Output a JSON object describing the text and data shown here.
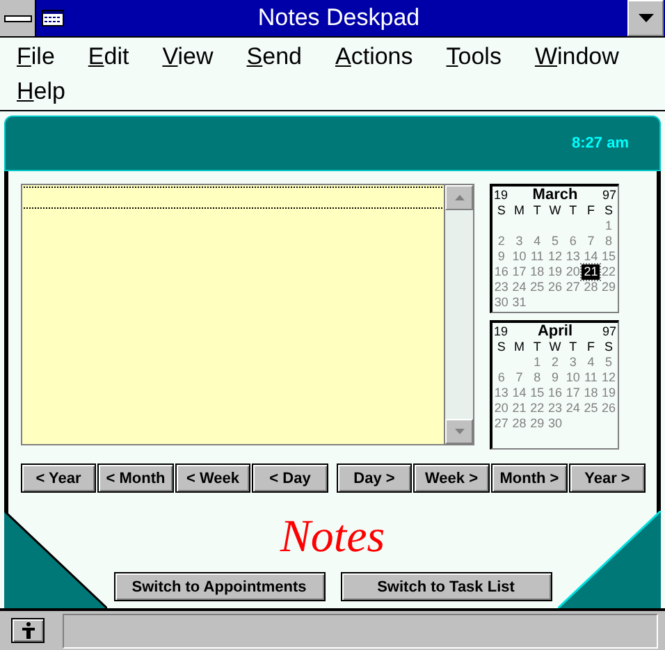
{
  "window": {
    "title": "Notes Deskpad"
  },
  "menu": [
    "File",
    "Edit",
    "View",
    "Send",
    "Actions",
    "Tools",
    "Window",
    "Help"
  ],
  "header": {
    "time": "8:27 am"
  },
  "calendars": [
    {
      "century": "19",
      "month": "March",
      "year": "97",
      "weekdays": [
        "S",
        "M",
        "T",
        "W",
        "T",
        "F",
        "S"
      ],
      "weeks": [
        [
          {
            "d": "1",
            "selected": false
          }
        ],
        [
          {
            "d": "2",
            "selected": false
          },
          {
            "d": "3",
            "selected": false
          },
          {
            "d": "4",
            "selected": false
          },
          {
            "d": "5",
            "selected": false
          },
          {
            "d": "6",
            "selected": false
          },
          {
            "d": "7",
            "selected": false
          },
          {
            "d": "8",
            "selected": false
          }
        ],
        [
          {
            "d": "9",
            "selected": false
          },
          {
            "d": "10",
            "selected": false
          },
          {
            "d": "11",
            "selected": false
          },
          {
            "d": "12",
            "selected": false
          },
          {
            "d": "13",
            "selected": false
          },
          {
            "d": "14",
            "selected": false
          },
          {
            "d": "15",
            "selected": false
          }
        ],
        [
          {
            "d": "16",
            "selected": false
          },
          {
            "d": "17",
            "selected": false
          },
          {
            "d": "18",
            "selected": false
          },
          {
            "d": "19",
            "selected": false
          },
          {
            "d": "20",
            "selected": false
          },
          {
            "d": "21",
            "selected": true
          },
          {
            "d": "22",
            "selected": false
          }
        ],
        [
          {
            "d": "23",
            "selected": false
          },
          {
            "d": "24",
            "selected": false
          },
          {
            "d": "25",
            "selected": false
          },
          {
            "d": "26",
            "selected": false
          },
          {
            "d": "27",
            "selected": false
          },
          {
            "d": "28",
            "selected": false
          },
          {
            "d": "29",
            "selected": false
          }
        ],
        [
          {
            "d": "30",
            "selected": false
          },
          {
            "d": "31",
            "selected": false
          }
        ]
      ]
    },
    {
      "century": "19",
      "month": "April",
      "year": "97",
      "weekdays": [
        "S",
        "M",
        "T",
        "W",
        "T",
        "F",
        "S"
      ],
      "weeks": [
        [
          {
            "d": "1",
            "selected": false
          },
          {
            "d": "2",
            "selected": false
          },
          {
            "d": "3",
            "selected": false
          },
          {
            "d": "4",
            "selected": false
          },
          {
            "d": "5",
            "selected": false
          }
        ],
        [
          {
            "d": "6",
            "selected": false
          },
          {
            "d": "7",
            "selected": false
          },
          {
            "d": "8",
            "selected": false
          },
          {
            "d": "9",
            "selected": false
          },
          {
            "d": "10",
            "selected": false
          },
          {
            "d": "11",
            "selected": false
          },
          {
            "d": "12",
            "selected": false
          }
        ],
        [
          {
            "d": "13",
            "selected": false
          },
          {
            "d": "14",
            "selected": false
          },
          {
            "d": "15",
            "selected": false
          },
          {
            "d": "16",
            "selected": false
          },
          {
            "d": "17",
            "selected": false
          },
          {
            "d": "18",
            "selected": false
          },
          {
            "d": "19",
            "selected": false
          }
        ],
        [
          {
            "d": "20",
            "selected": false
          },
          {
            "d": "21",
            "selected": false
          },
          {
            "d": "22",
            "selected": false
          },
          {
            "d": "23",
            "selected": false
          },
          {
            "d": "24",
            "selected": false
          },
          {
            "d": "25",
            "selected": false
          },
          {
            "d": "26",
            "selected": false
          }
        ],
        [
          {
            "d": "27",
            "selected": false
          },
          {
            "d": "28",
            "selected": false
          },
          {
            "d": "29",
            "selected": false
          },
          {
            "d": "30",
            "selected": false
          }
        ]
      ]
    }
  ],
  "nav_back": [
    "< Year",
    "< Month",
    "< Week",
    "< Day"
  ],
  "nav_forward": [
    "Day >",
    "Week >",
    "Month >",
    "Year >"
  ],
  "section_title": "Notes",
  "switch_buttons": [
    "Switch to Appointments",
    "Switch to Task List"
  ]
}
